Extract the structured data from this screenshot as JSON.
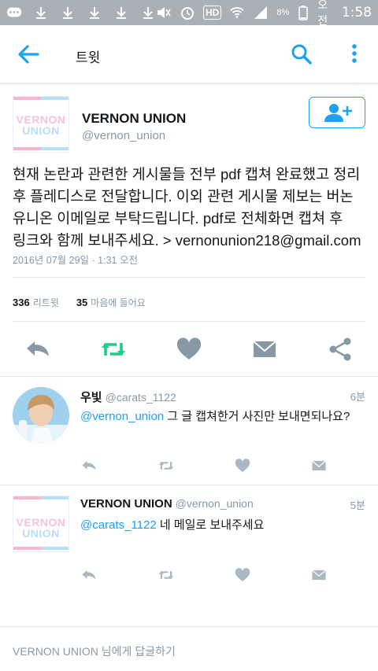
{
  "status_bar": {
    "battery_text": "8%",
    "ampm": "오전",
    "time": "1:58",
    "hd_label": "HD",
    "colors": {
      "background": "#a9b0b6"
    }
  },
  "app_bar": {
    "title": "트윗",
    "icons": [
      "back-arrow-icon",
      "search-icon",
      "more-vert-icon"
    ]
  },
  "main_tweet": {
    "avatar_text": [
      "VERNON",
      "UNION"
    ],
    "name": "VERNON UNION",
    "handle": "@vernon_union",
    "text_lines": [
      "현재 논란과 관련한 게시물들 전부 pdf 캡쳐 완료했고 정리",
      "후 플레디스로 전달합니다. 이외 관련 게시물 제보는 버논",
      "유니온 이메일로 부탁드립니다. pdf로 전체화면 캡쳐 후",
      "링크와 함께 보내주세요. > vernonunion218@gmail.com"
    ],
    "date": "2016년 07월 29일 · 1:31 오전",
    "retweet_count": "336",
    "retweet_label": "리트윗",
    "like_count": "35",
    "like_label": "마음에 들어요"
  },
  "replies": [
    {
      "name": "우빛",
      "handle": "@carats_1122",
      "time": "6분",
      "mention": "@vernon_union",
      "text": " 그 글 캡쳐한거 사진만 보내면되나요?"
    },
    {
      "name": "VERNON UNION",
      "handle": "@vernon_union",
      "time": "5분",
      "mention": "@carats_1122",
      "text": " 네 메일로 보내주세요"
    }
  ],
  "compose": {
    "target": "VERNON UNION",
    "suffix": " 님에게 답글하기"
  },
  "colors": {
    "accent": "#1da1f2",
    "retweet_active": "#19cf86",
    "icon_gray": "#8899a6",
    "text": "#14171a"
  }
}
